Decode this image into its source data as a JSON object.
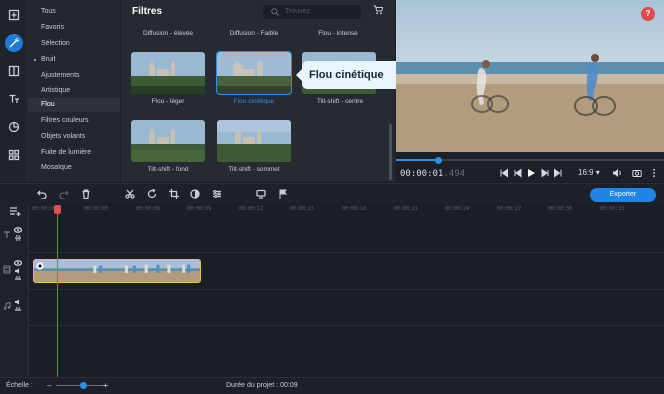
{
  "categories": [
    {
      "label": "Tous",
      "bullet": false
    },
    {
      "label": "Favoris",
      "bullet": false
    },
    {
      "label": "Sélection",
      "bullet": false
    },
    {
      "label": "Bruit",
      "bullet": true
    },
    {
      "label": "Ajustements",
      "bullet": false
    },
    {
      "label": "Artistique",
      "bullet": false
    },
    {
      "label": "Flou",
      "bullet": false,
      "selected": true
    },
    {
      "label": "Filtres couleurs",
      "bullet": false
    },
    {
      "label": "Objets volants",
      "bullet": false
    },
    {
      "label": "Fuite de lumière",
      "bullet": false
    },
    {
      "label": "Mosaïque",
      "bullet": false
    }
  ],
  "filters": {
    "title": "Filtres",
    "search_placeholder": "Trouvez",
    "top_labels": [
      "Diffusion - élevée",
      "Diffusion - Faible",
      "Flou - intense"
    ],
    "items": [
      {
        "label": "Flou - léger",
        "selected": false
      },
      {
        "label": "Flou cinétique",
        "selected": true
      },
      {
        "label": "Tilt-shift - centre",
        "selected": false
      },
      {
        "label": "Tilt-shift - fond",
        "selected": false
      },
      {
        "label": "Tilt-shift - sommet",
        "selected": false
      }
    ]
  },
  "tooltip": "Flou cinétique",
  "help": "?",
  "player": {
    "timecode": "00:00:01",
    "timecode_frames": ".494",
    "progress": 0.16,
    "aspect": "16:9 ▾"
  },
  "toolbar": {
    "export_label": "Exporter"
  },
  "ruler_ticks": [
    "00:00:00",
    "00:00:03",
    "00:00:06",
    "00:00:09",
    "00:00:12",
    "00:00:15",
    "00:00:18",
    "00:00:21",
    "00:00:24",
    "00:00:27",
    "00:00:30",
    "00:00:33"
  ],
  "status": {
    "scale_label": "Échelle :",
    "duration_label": "Durée du projet : 00:09",
    "zoom": 0.53
  },
  "colors": {
    "accent": "#1f86e8",
    "playhead": "#e05050",
    "clip_border": "#e8c34a",
    "tooltip_bg": "#e9f4fd"
  }
}
